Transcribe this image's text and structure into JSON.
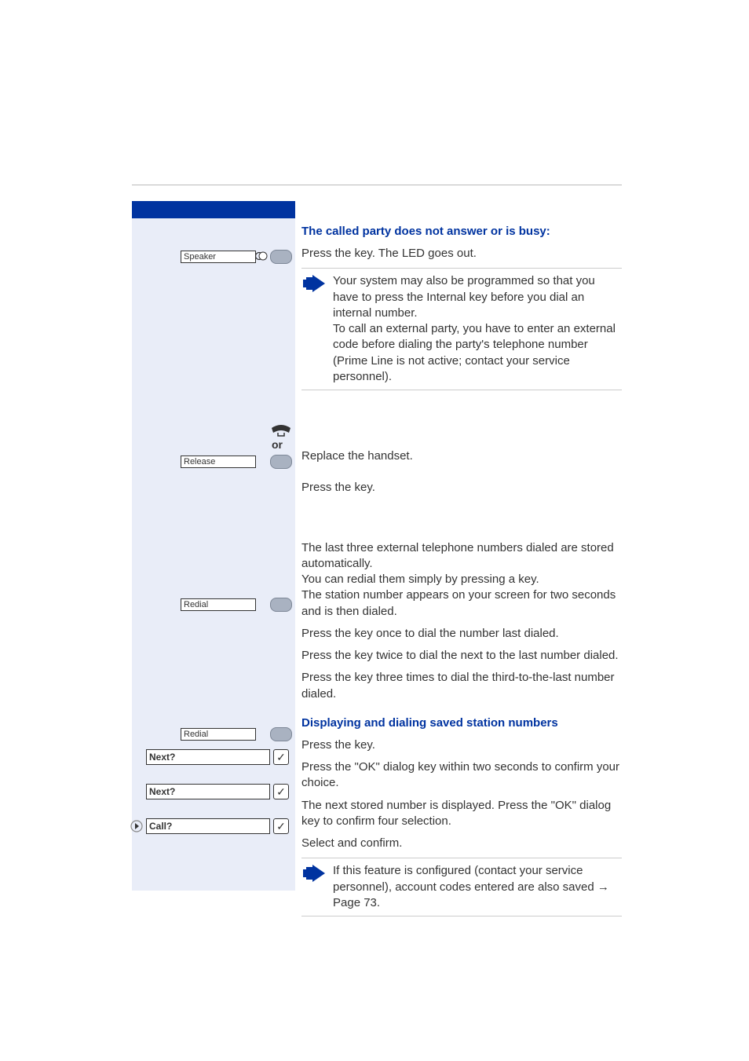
{
  "titles": {
    "no_answer": "The called party does not answer or is busy:",
    "display_dial": "Displaying and dialing saved station numbers"
  },
  "keys": {
    "speaker": "Speaker",
    "release": "Release",
    "redial": "Redial",
    "or": "or"
  },
  "menu": {
    "next": "Next?",
    "call": "Call?"
  },
  "text": {
    "press_led": "Press the key. The LED goes out.",
    "note1_l1": "Your system may also be programmed so that you have to press the Internal key before you dial an internal number.",
    "note1_l2": "To call an external party, you have to enter an external code before dialing the party's telephone number (Prime Line is not active; contact your service personnel).",
    "replace_handset": "Replace the handset.",
    "press_key": "Press the key.",
    "redial_intro": "The last three external telephone numbers dialed are stored automatically.\nYou can redial them simply by pressing a key.\nThe station number appears on your screen for two seconds and is then dialed.",
    "press_once": "Press the key once to dial the number last dialed.",
    "press_twice": "Press the key twice to dial the next to the last number dialed.",
    "press_three": "Press the key three times to dial the third-to-the-last number dialed.",
    "press_key2": "Press the key.",
    "ok_confirm": "Press the \"OK\" dialog key within two seconds to confirm your choice.",
    "next_stored": "The next stored number is displayed. Press the \"OK\" dialog key to confirm four selection.",
    "select_confirm": "Select and confirm.",
    "note2_pre": "If this feature is configured (contact your service personnel), account codes entered are also saved ",
    "note2_arrow": "→",
    "note2_page": " Page 73."
  }
}
